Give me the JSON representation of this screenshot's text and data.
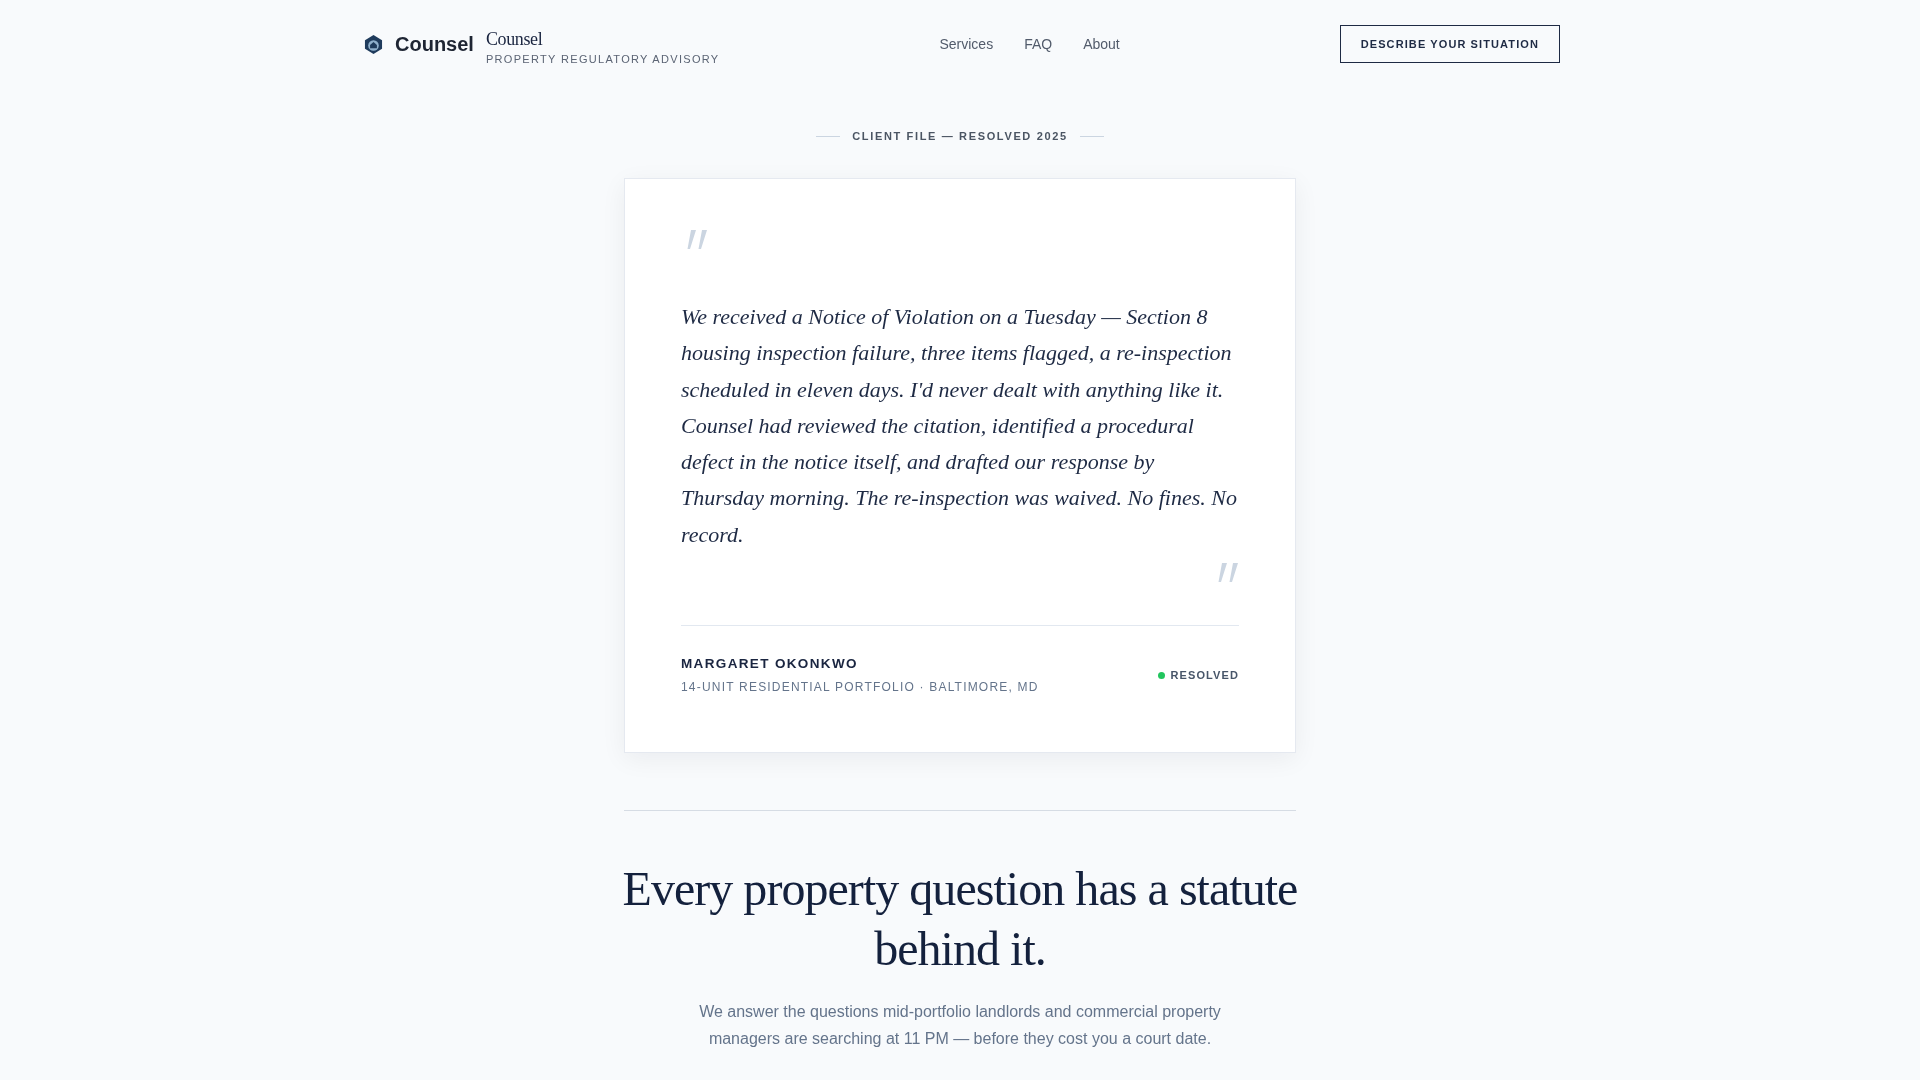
{
  "header": {
    "brand": {
      "name": "Counsel",
      "wordmark": "Counsel",
      "tagline": "PROPERTY REGULATORY ADVISORY"
    },
    "nav": [
      {
        "label": "Services"
      },
      {
        "label": "FAQ"
      },
      {
        "label": "About"
      }
    ],
    "cta": {
      "label": "DESCRIBE YOUR SITUATION"
    }
  },
  "testimonial": {
    "eyebrow": "CLIENT FILE — RESOLVED 2025",
    "quote": "We received a Notice of Violation on a Tuesday — Section 8 housing inspection failure, three items flagged, a re-inspection scheduled in eleven days. I'd never dealt with anything like it. Counsel had reviewed the citation, identified a procedural defect in the notice itself, and drafted our response by Thursday morning. The re-inspection was waived. No fines. No record.",
    "author": {
      "name": "MARGARET OKONKWO",
      "details": "14-UNIT RESIDENTIAL PORTFOLIO · BALTIMORE, MD"
    },
    "status": {
      "label": "RESOLVED",
      "color": "#22c55e"
    }
  },
  "intro": {
    "heading": "Every property question has a statute behind it.",
    "text": "We answer the questions mid-portfolio landlords and commercial property managers are searching at 11 PM — before they cost you a court date."
  }
}
